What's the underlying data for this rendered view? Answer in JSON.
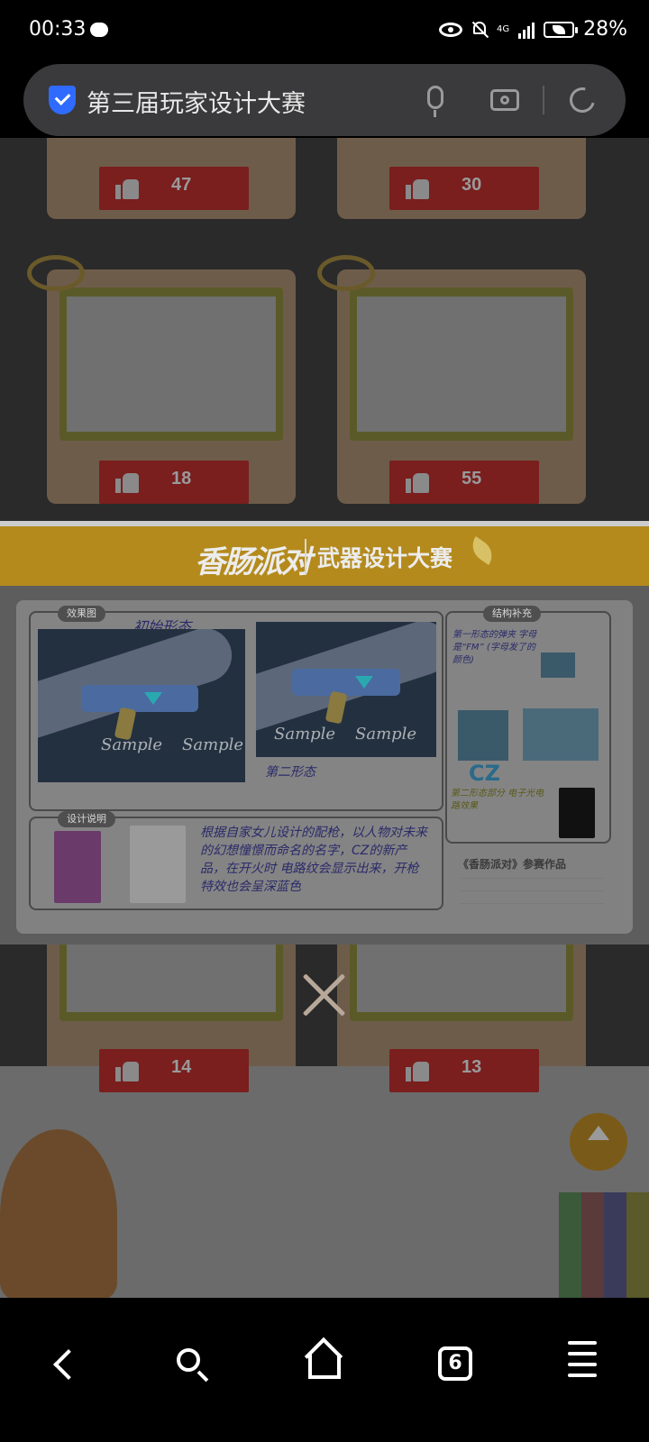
{
  "status_bar": {
    "time": "00:33",
    "network": "4G",
    "battery": "28%"
  },
  "url_bar": {
    "title": "第三届玩家设计大赛"
  },
  "page_cards": [
    {
      "likes": "47"
    },
    {
      "likes": "30"
    },
    {
      "likes": "18"
    },
    {
      "likes": "55"
    },
    {
      "likes": "14"
    },
    {
      "likes": "13"
    }
  ],
  "modal": {
    "brand": "香肠派对",
    "contest_title": "武器设计大赛",
    "panel_effect_label": "效果图",
    "panel_structure_label": "结构补充",
    "panel_design_label": "设计说明",
    "form1_note": "初始形态",
    "form2_note": "第二形态",
    "structure_note1": "第一形态的弹夹 字母是“FM” (字母发了的颜色)",
    "structure_note2": "第二形态部分 电子光电路效果",
    "cz_text": "CZ",
    "design_text": "根据自家女儿设计的配枪，以人物对未来的幻想憧憬而命名的名字，CZ的新产品，在开火时 电路纹会显示出来，开枪特效也会呈深蓝色",
    "reference_caption": "《香肠派对》参赛作品",
    "watermark": "Sample"
  },
  "colors": {
    "header_gold": "#b48a1c",
    "like_red": "#7a1e1e",
    "notification_red": "#ff3b30",
    "shield_blue": "#2f6bff"
  },
  "bottom_nav": {
    "tab_count": "6"
  }
}
